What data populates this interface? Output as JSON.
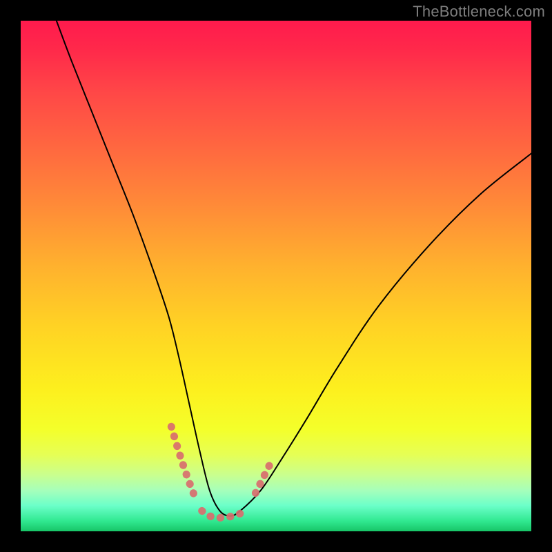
{
  "watermark": "TheBottleneck.com",
  "chart_data": {
    "type": "line",
    "title": "",
    "xlabel": "",
    "ylabel": "",
    "xlim": [
      0,
      100
    ],
    "ylim": [
      0,
      100
    ],
    "grid": false,
    "series": [
      {
        "name": "bottleneck-curve",
        "color": "#000000",
        "stroke_width": 2,
        "x": [
          7,
          10,
          14,
          18,
          22,
          26,
          29,
          31,
          33,
          35,
          37,
          39,
          41,
          43,
          47,
          51,
          56,
          62,
          70,
          80,
          90,
          100
        ],
        "y": [
          100,
          92,
          82,
          72,
          62,
          51,
          42,
          34,
          25,
          16,
          8,
          4,
          3,
          4,
          8,
          14,
          22,
          32,
          44,
          56,
          66,
          74
        ]
      },
      {
        "name": "highlight-segments",
        "color": "#d86e6e",
        "stroke_width": 11,
        "segments": [
          {
            "x": [
              29.5,
              31.0,
              32.5,
              34.0
            ],
            "y": [
              20.5,
              15.5,
              11.0,
              7.0
            ]
          },
          {
            "x": [
              35.5,
              37.0,
              38.5,
              40.0,
              41.5,
              43.0,
              44.5
            ],
            "y": [
              4.0,
              3.0,
              2.7,
              2.7,
              3.0,
              3.5,
              4.5
            ]
          },
          {
            "x": [
              46.0,
              47.5,
              49.0
            ],
            "y": [
              7.5,
              10.5,
              13.5
            ]
          }
        ]
      }
    ]
  },
  "colors": {
    "frame": "#000000",
    "watermark": "#7d7d7d"
  }
}
